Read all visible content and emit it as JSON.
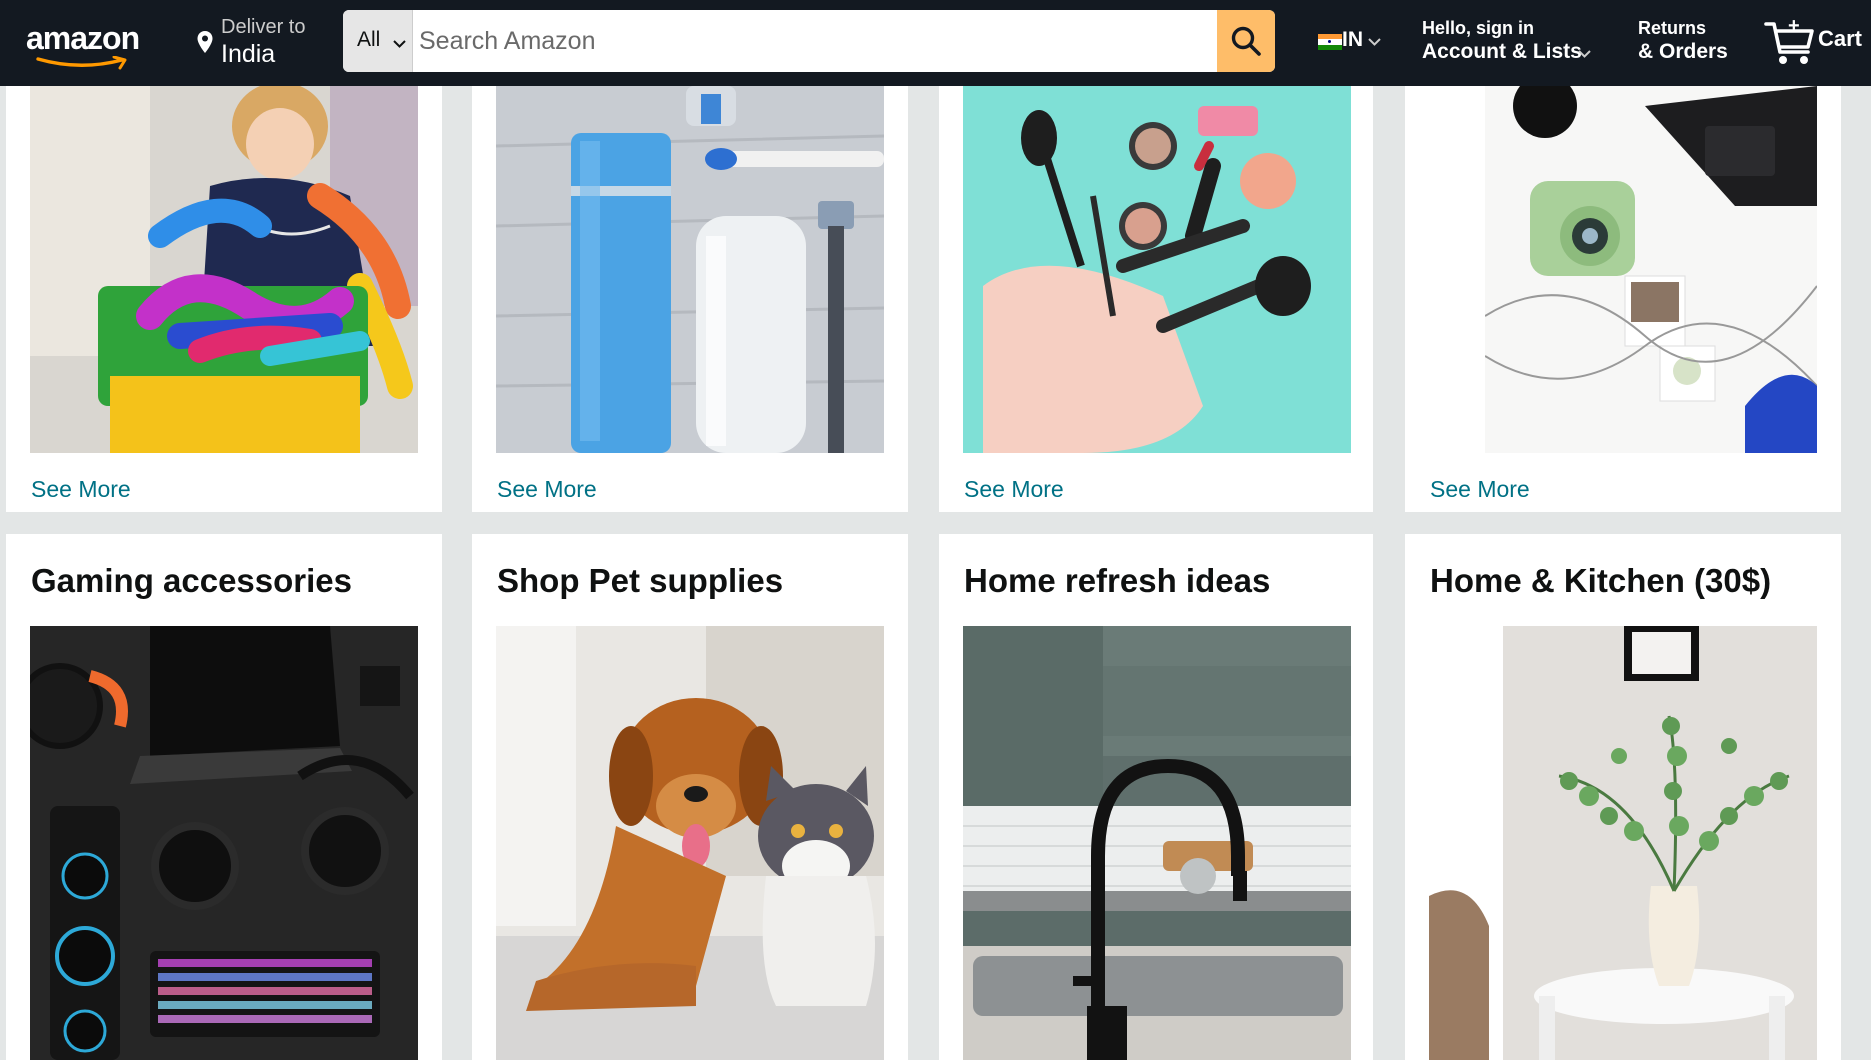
{
  "header": {
    "logo_text": "amazon",
    "deliver_line1": "Deliver to",
    "deliver_line2": "India",
    "search_category": "All",
    "search_placeholder": "Search Amazon",
    "language_code": "IN",
    "account_line1": "Hello, sign in",
    "account_line2": "Account & Lists",
    "returns_line1": "Returns",
    "returns_line2": "& Orders",
    "cart_label": "Cart",
    "colors": {
      "nav_bg": "#131921",
      "search_button": "#febd69",
      "logo_smile": "#ff9900"
    }
  },
  "top_row": [
    {
      "image": "kids-toys-photo",
      "link": "See More"
    },
    {
      "image": "personal-care-photo",
      "link": "See More"
    },
    {
      "image": "makeup-photo",
      "link": "See More"
    },
    {
      "image": "instant-camera-photo",
      "link": "See More"
    }
  ],
  "bottom_row": [
    {
      "title": "Gaming accessories",
      "image": "gaming-setup-photo"
    },
    {
      "title": "Shop Pet supplies",
      "image": "dog-and-cat-photo"
    },
    {
      "title": "Home refresh ideas",
      "image": "kitchen-faucet-photo"
    },
    {
      "title": "Home & Kitchen (30$)",
      "image": "vase-plant-photo"
    }
  ],
  "colors": {
    "page_bg": "#e3e6e6",
    "link": "#007185"
  }
}
